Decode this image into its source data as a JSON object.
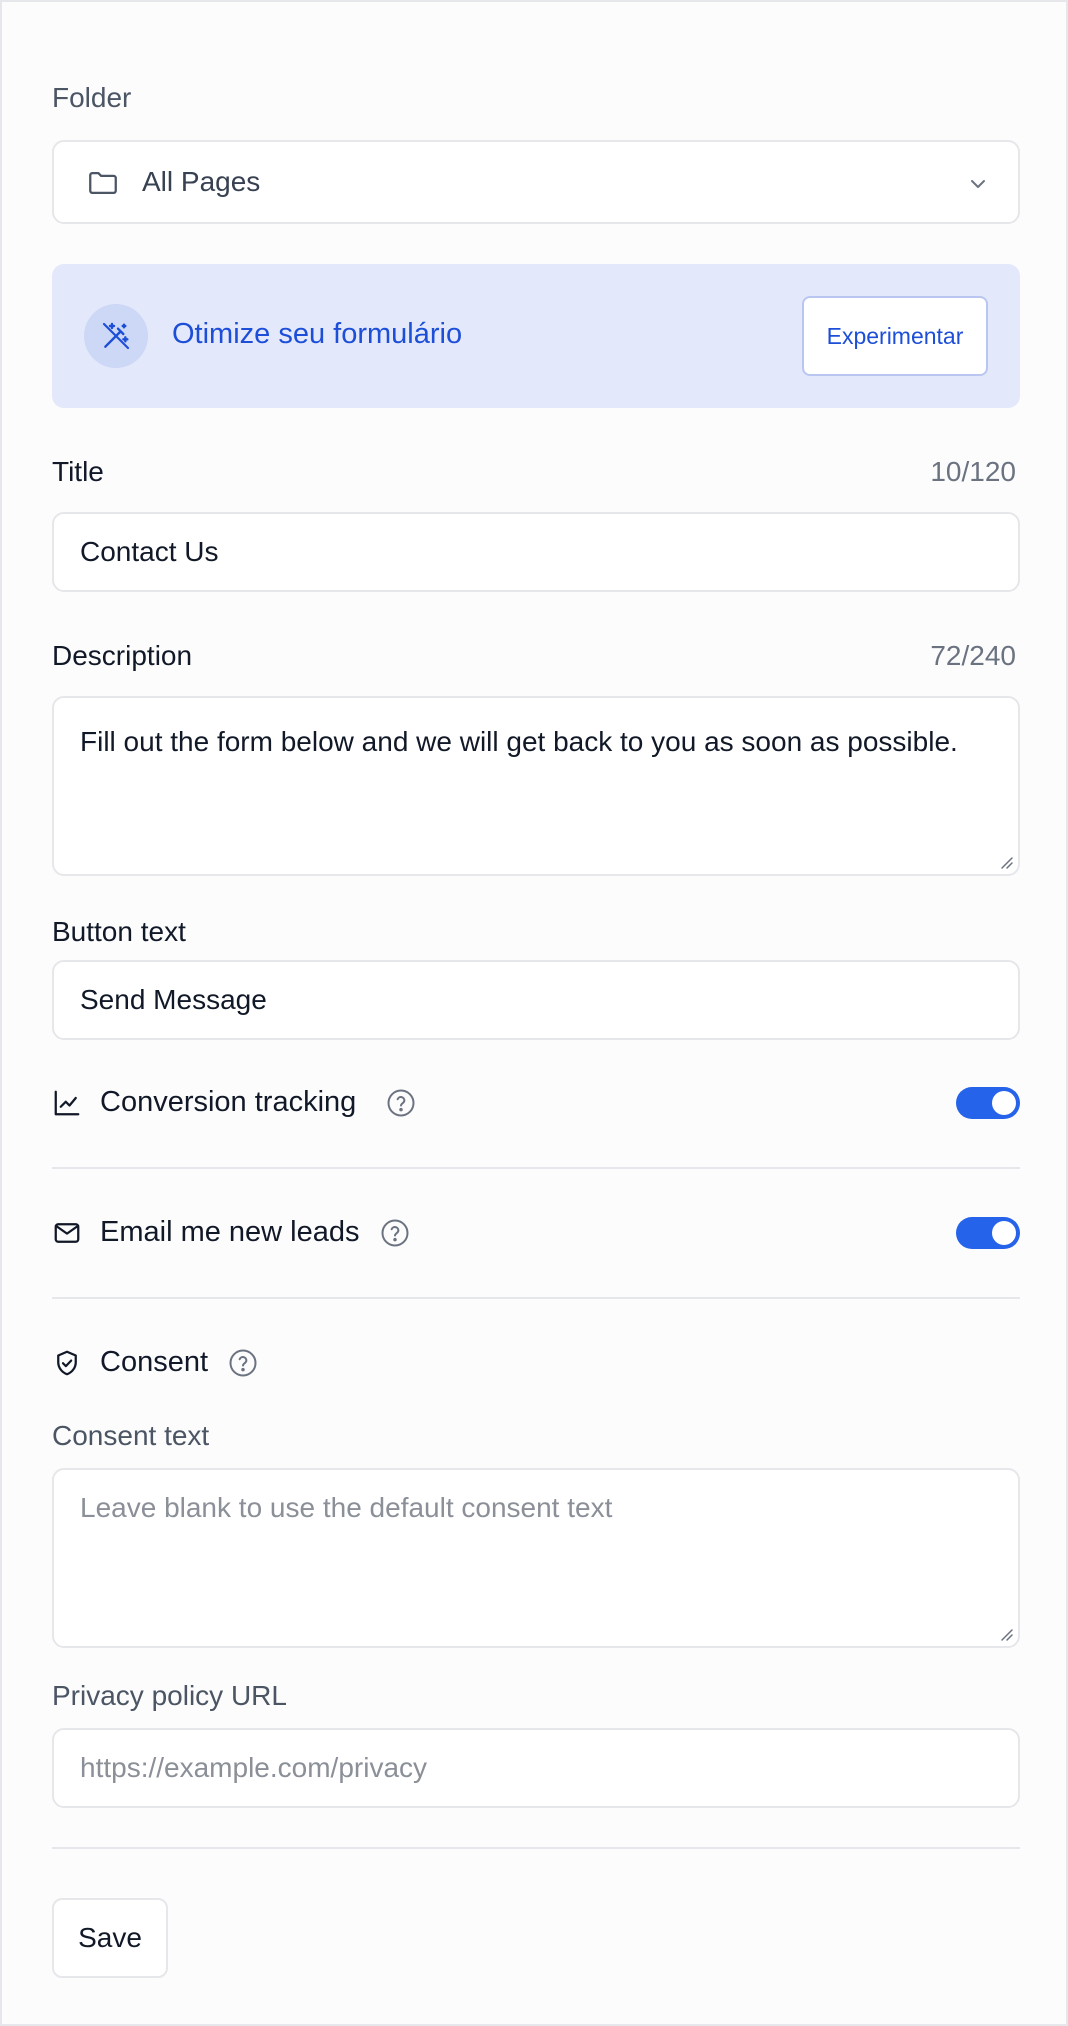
{
  "folder": {
    "label": "Folder",
    "selected": "All Pages"
  },
  "promo": {
    "text": "Otimize seu formulário",
    "button": "Experimentar"
  },
  "title": {
    "label": "Title",
    "counter": "10/120",
    "value": "Contact Us"
  },
  "description": {
    "label": "Description",
    "counter": "72/240",
    "value": "Fill out the form below and we will get back to you as soon as possible."
  },
  "button_text": {
    "label": "Button text",
    "value": "Send Message"
  },
  "conversion": {
    "label": "Conversion tracking",
    "enabled": true
  },
  "email_leads": {
    "label": "Email me new leads",
    "enabled": true
  },
  "consent": {
    "heading": "Consent",
    "text_label": "Consent text",
    "text_placeholder": "Leave blank to use the default consent text",
    "privacy_label": "Privacy policy URL",
    "privacy_placeholder": "https://example.com/privacy"
  },
  "actions": {
    "save": "Save"
  },
  "colors": {
    "accent": "#2563eb",
    "promo_bg": "#e3e9fb",
    "promo_text": "#1d4ed8"
  }
}
